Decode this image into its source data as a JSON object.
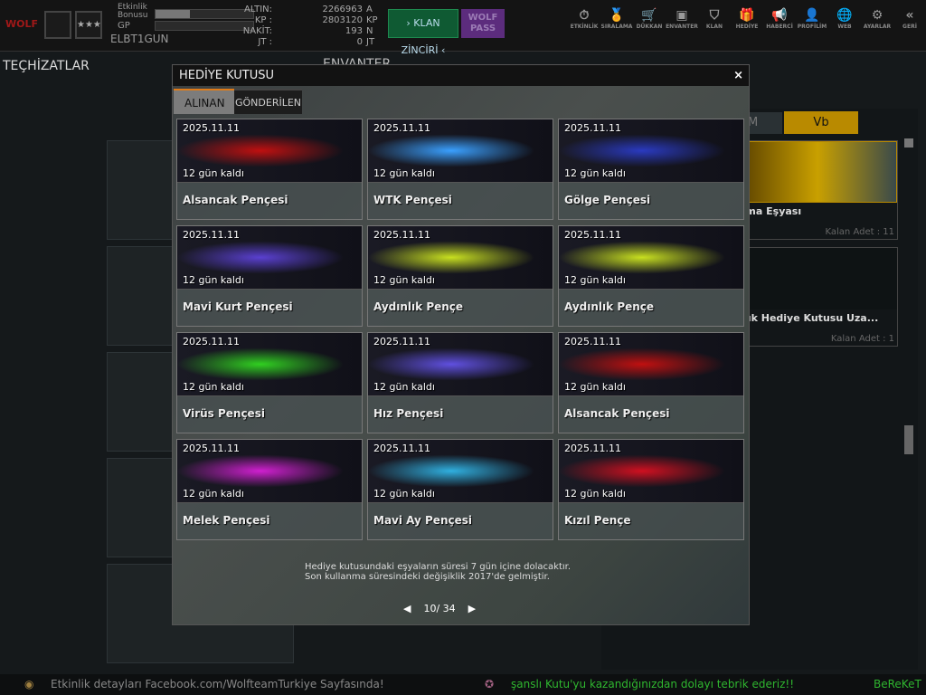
{
  "topbar": {
    "logo": "WOLF",
    "badge_stars": "★★★",
    "event_bonus_label": "Etkinlik Bonusu",
    "event_bonus_fill": 0.35,
    "gp_label": "GP",
    "gp_fill": 0,
    "username": "ELBT1GUN",
    "currency": [
      {
        "label": "ALTIN:",
        "value": "2266963",
        "unit": "A"
      },
      {
        "label": "KP :",
        "value": "2803120",
        "unit": "KP"
      },
      {
        "label": "NAKİT:",
        "value": "193",
        "unit": "N"
      },
      {
        "label": "JT :",
        "value": "0",
        "unit": "JT"
      }
    ],
    "klan_chain": "› KLAN ZİNCİRİ ‹",
    "wolf_pass": "WOLF PASS",
    "nav": [
      {
        "label": "ETKİNLİK",
        "icon": "⏱"
      },
      {
        "label": "SIRALAMA",
        "icon": "🏅"
      },
      {
        "label": "DÜKKAN",
        "icon": "🛒"
      },
      {
        "label": "ENVANTER",
        "icon": "▣"
      },
      {
        "label": "KLAN",
        "icon": "⛉"
      },
      {
        "label": "HEDİYE",
        "icon": "🎁"
      },
      {
        "label": "HABERCİ",
        "icon": "📢"
      },
      {
        "label": "PROFİLİM",
        "icon": "👤"
      },
      {
        "label": "WEB",
        "icon": "🌐"
      },
      {
        "label": "AYARLAR",
        "icon": "⚙"
      },
      {
        "label": "GERİ",
        "icon": "«"
      }
    ]
  },
  "background": {
    "left_title": "TEÇHİZATLAR",
    "center_title": "ENVANTER",
    "right_tabs": [
      "M",
      "Vb"
    ],
    "right_items": [
      {
        "name": "rma Eşyası",
        "count": "Kalan Adet : 11"
      },
      {
        "name": "lük Hediye Kutusu Uza...",
        "count": "Kalan Adet : 1"
      }
    ]
  },
  "modal": {
    "title": "HEDİYE KUTUSU",
    "close": "×",
    "tabs": [
      "ALINAN",
      "GÖNDERİLEN"
    ],
    "items": [
      {
        "date": "2025.11.11",
        "left": "12 gün kaldı",
        "name": "Alsancak Pençesi",
        "color": "#c01010"
      },
      {
        "date": "2025.11.11",
        "left": "12 gün kaldı",
        "name": "WTK Pençesi",
        "color": "#3aa0ff"
      },
      {
        "date": "2025.11.11",
        "left": "12 gün kaldı",
        "name": "Gölge Pençesi",
        "color": "#2a3ac0"
      },
      {
        "date": "2025.11.11",
        "left": "12 gün kaldı",
        "name": "Mavi Kurt Pençesi",
        "color": "#5a40d0"
      },
      {
        "date": "2025.11.11",
        "left": "12 gün kaldı",
        "name": "Aydınlık Pençe",
        "color": "#c8e020"
      },
      {
        "date": "2025.11.11",
        "left": "12 gün kaldı",
        "name": "Aydınlık Pençe",
        "color": "#c8e020"
      },
      {
        "date": "2025.11.11",
        "left": "12 gün kaldı",
        "name": "Virüs Pençesi",
        "color": "#30d020"
      },
      {
        "date": "2025.11.11",
        "left": "12 gün kaldı",
        "name": "Hız Pençesi",
        "color": "#6050e0"
      },
      {
        "date": "2025.11.11",
        "left": "12 gün kaldı",
        "name": "Alsancak Pençesi",
        "color": "#c01010"
      },
      {
        "date": "2025.11.11",
        "left": "12 gün kaldı",
        "name": "Melek Pençesi",
        "color": "#d020d0"
      },
      {
        "date": "2025.11.11",
        "left": "12 gün kaldı",
        "name": "Mavi Ay Pençesi",
        "color": "#30b0e0"
      },
      {
        "date": "2025.11.11",
        "left": "12 gün kaldı",
        "name": "Kızıl Pençe",
        "color": "#d01020"
      }
    ],
    "note_line1": "Hediye kutusundaki eşyaların süresi 7 gün içine dolacaktır.",
    "note_line2": "Son kullanma süresindeki değişiklik 2017'de gelmiştir.",
    "page": "10/ 34"
  },
  "ticker": {
    "msg1": "Etkinlik detayları Facebook.com/WolfteamTurkiye Sayfasında!",
    "msg2": "şanslı Kutu'yu kazandığınızdan dolayı tebrik ederiz!!",
    "msg3": "BeReKeT"
  }
}
